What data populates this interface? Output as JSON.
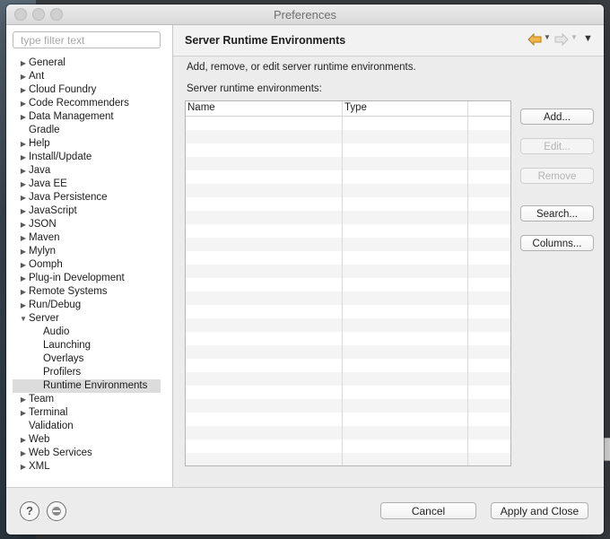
{
  "window": {
    "title": "Preferences"
  },
  "filter": {
    "placeholder": "type filter text",
    "value": ""
  },
  "tree": [
    {
      "label": "General",
      "expandable": true,
      "expanded": false,
      "level": 0
    },
    {
      "label": "Ant",
      "expandable": true,
      "expanded": false,
      "level": 0
    },
    {
      "label": "Cloud Foundry",
      "expandable": true,
      "expanded": false,
      "level": 0
    },
    {
      "label": "Code Recommenders",
      "expandable": true,
      "expanded": false,
      "level": 0
    },
    {
      "label": "Data Management",
      "expandable": true,
      "expanded": false,
      "level": 0
    },
    {
      "label": "Gradle",
      "expandable": false,
      "level": 0
    },
    {
      "label": "Help",
      "expandable": true,
      "expanded": false,
      "level": 0
    },
    {
      "label": "Install/Update",
      "expandable": true,
      "expanded": false,
      "level": 0
    },
    {
      "label": "Java",
      "expandable": true,
      "expanded": false,
      "level": 0
    },
    {
      "label": "Java EE",
      "expandable": true,
      "expanded": false,
      "level": 0
    },
    {
      "label": "Java Persistence",
      "expandable": true,
      "expanded": false,
      "level": 0
    },
    {
      "label": "JavaScript",
      "expandable": true,
      "expanded": false,
      "level": 0
    },
    {
      "label": "JSON",
      "expandable": true,
      "expanded": false,
      "level": 0
    },
    {
      "label": "Maven",
      "expandable": true,
      "expanded": false,
      "level": 0
    },
    {
      "label": "Mylyn",
      "expandable": true,
      "expanded": false,
      "level": 0
    },
    {
      "label": "Oomph",
      "expandable": true,
      "expanded": false,
      "level": 0
    },
    {
      "label": "Plug-in Development",
      "expandable": true,
      "expanded": false,
      "level": 0
    },
    {
      "label": "Remote Systems",
      "expandable": true,
      "expanded": false,
      "level": 0
    },
    {
      "label": "Run/Debug",
      "expandable": true,
      "expanded": false,
      "level": 0
    },
    {
      "label": "Server",
      "expandable": true,
      "expanded": true,
      "level": 0
    },
    {
      "label": "Audio",
      "expandable": false,
      "level": 1
    },
    {
      "label": "Launching",
      "expandable": false,
      "level": 1
    },
    {
      "label": "Overlays",
      "expandable": false,
      "level": 1
    },
    {
      "label": "Profilers",
      "expandable": false,
      "level": 1
    },
    {
      "label": "Runtime Environments",
      "expandable": false,
      "level": 1,
      "selected": true
    },
    {
      "label": "Team",
      "expandable": true,
      "expanded": false,
      "level": 0
    },
    {
      "label": "Terminal",
      "expandable": true,
      "expanded": false,
      "level": 0
    },
    {
      "label": "Validation",
      "expandable": false,
      "level": 0
    },
    {
      "label": "Web",
      "expandable": true,
      "expanded": false,
      "level": 0
    },
    {
      "label": "Web Services",
      "expandable": true,
      "expanded": false,
      "level": 0
    },
    {
      "label": "XML",
      "expandable": true,
      "expanded": false,
      "level": 0
    }
  ],
  "page": {
    "title": "Server Runtime Environments",
    "description": "Add, remove, or edit server runtime environments.",
    "list_label": "Server runtime environments:",
    "columns": [
      "Name",
      "Type"
    ],
    "rows": []
  },
  "buttons": {
    "add": "Add...",
    "edit": "Edit...",
    "remove": "Remove",
    "search": "Search...",
    "columns": "Columns..."
  },
  "footer": {
    "help_icon": "?",
    "cancel": "Cancel",
    "apply_close": "Apply and Close"
  },
  "colors": {
    "selection": "#dcdcdc",
    "nav_back_arrow": "#e8a530"
  }
}
